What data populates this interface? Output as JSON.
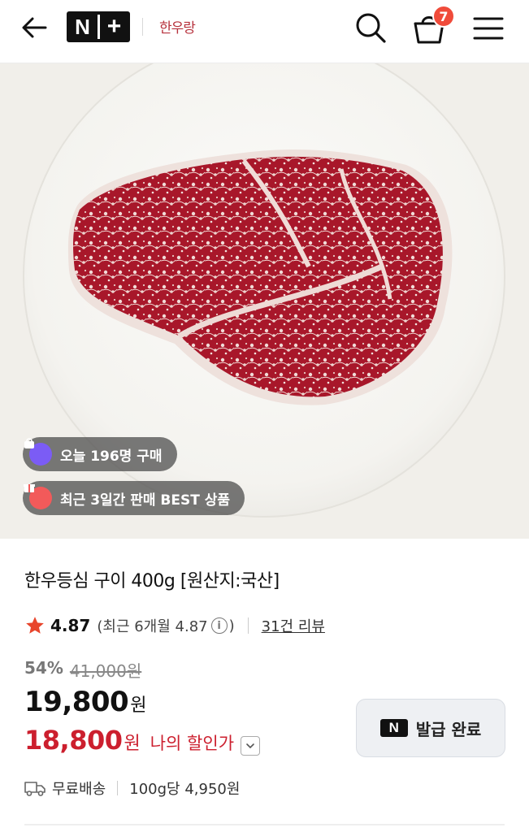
{
  "header": {
    "nplus_n": "N",
    "nplus_plus": "+",
    "brand_logo": "한우랑",
    "cart_count": "7",
    "icons": [
      "back-arrow-icon",
      "search-icon",
      "cart-icon",
      "menu-icon"
    ]
  },
  "hero": {
    "image": "marbled-beef-steak-on-white-plate",
    "badges": [
      {
        "text": "오늘 196명 구매",
        "icon": "bag-icon",
        "icon_color": "#7b5cf5"
      },
      {
        "text": "최근 3일간 판매 BEST 상품",
        "icon": "gift-icon",
        "icon_color": "#f25a5a"
      }
    ]
  },
  "product": {
    "title": "한우등심 구이 400g [원산지:국산]",
    "rating": "4.87",
    "recent_rating": "(최근 6개월 4.87",
    "recent_close": ")",
    "info_icon": "i",
    "reviews": "31건 리뷰",
    "discount_pct": "54%",
    "original_price": "41,000원",
    "price": "19,800",
    "price_unit": "원",
    "my_price": "18,800",
    "my_price_unit": "원",
    "my_price_label": "나의 할인가",
    "coupon_icon_text": "N",
    "coupon_label": "발급 완료",
    "shipping": "무료배송",
    "unit_price": "100g당 4,950원"
  },
  "colors": {
    "accent_red": "#cc1f2e",
    "star": "#e8452c",
    "cart_badge": "#f04b3a"
  }
}
